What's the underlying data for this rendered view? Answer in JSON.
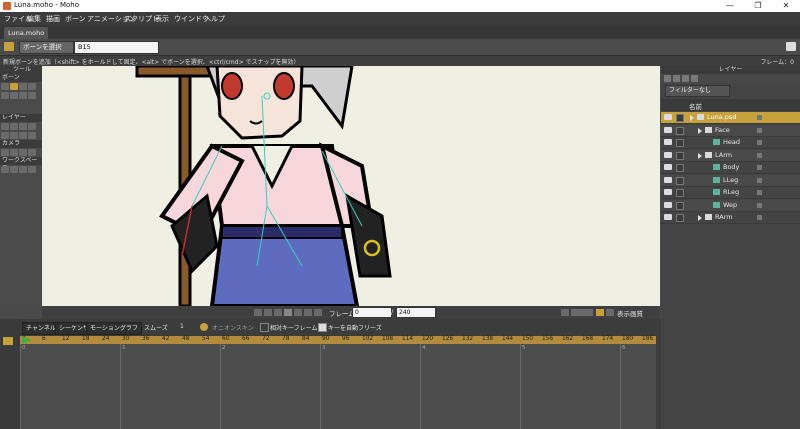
{
  "window": {
    "title": "Luna.moho - Moho",
    "controls": [
      "—",
      "❐",
      "✕"
    ]
  },
  "menubar": [
    "ファイル",
    "編集",
    "描画",
    "ボーン",
    "アニメーション",
    "スクリプト",
    "表示",
    "ウインドウ",
    "ヘルプ"
  ],
  "document_tab": "Luna.moho",
  "tool_options": {
    "bone_select_label": "ボーンを選択",
    "bone_name": "B15"
  },
  "status": {
    "hint": "新規ボーンを追加（<shift> をホールドして固定、<alt> でボーンを選択、<ctrl/cmd> でスナップを無効）",
    "frame_label": "フレーム：0"
  },
  "tools_panel": {
    "title": "ツール",
    "sections": [
      "ボーン",
      "レイヤー",
      "カメラ",
      "ワークスペース"
    ]
  },
  "playback": {
    "frame_label": "フレーム",
    "frame_value": "0",
    "frame_total": "240",
    "quality_label": "表示画質"
  },
  "timeline": {
    "tabs": [
      "チャンネル",
      "シーケンサ",
      "モーショングラフ"
    ],
    "smooth_label": "スムーズ",
    "smooth_value": "1",
    "onion_label": "オニオンスキン",
    "relative_keyframe_label": "相対キーフレーム",
    "auto_freeze_label": "キーを自動フリーズ",
    "ruler": [
      "0",
      "6",
      "12",
      "18",
      "24",
      "30",
      "36",
      "42",
      "48",
      "54",
      "60",
      "66",
      "72",
      "78",
      "84",
      "90",
      "96",
      "102",
      "108",
      "114",
      "120",
      "126",
      "132",
      "138",
      "144",
      "150",
      "156",
      "162",
      "168",
      "174",
      "180",
      "186"
    ],
    "seconds": [
      "0",
      "1",
      "2",
      "3",
      "4",
      "5",
      "6"
    ]
  },
  "layers_panel": {
    "title": "レイヤー",
    "filter": "フィルターなし",
    "column_name": "名前",
    "layers": [
      {
        "name": "Luna.psd",
        "type": "group",
        "indent": 0,
        "selected": true
      },
      {
        "name": "Face",
        "type": "group",
        "indent": 1,
        "selected": false
      },
      {
        "name": "Head",
        "type": "image",
        "indent": 2,
        "selected": false
      },
      {
        "name": "LArm",
        "type": "group",
        "indent": 1,
        "selected": false
      },
      {
        "name": "Body",
        "type": "image",
        "indent": 2,
        "selected": false
      },
      {
        "name": "LLeg",
        "type": "image",
        "indent": 2,
        "selected": false
      },
      {
        "name": "RLeg",
        "type": "image",
        "indent": 2,
        "selected": false
      },
      {
        "name": "Wep",
        "type": "image",
        "indent": 2,
        "selected": false
      },
      {
        "name": "RArm",
        "type": "group",
        "indent": 1,
        "selected": false
      }
    ]
  },
  "colors": {
    "accent": "#c7a23b",
    "canvas_bg": "#f0efe4",
    "ruler": "#b28b3c"
  }
}
